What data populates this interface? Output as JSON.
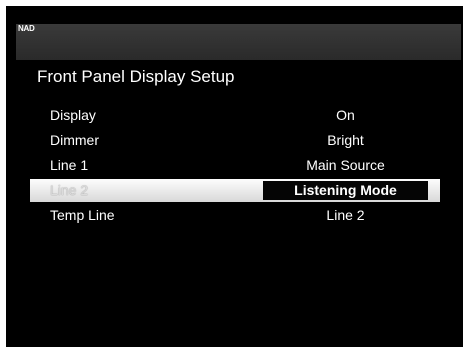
{
  "header": {
    "brand": "NAD",
    "title": "Front Panel Display Setup"
  },
  "menu": {
    "items": [
      {
        "label": "Display",
        "value": "On"
      },
      {
        "label": "Dimmer",
        "value": "Bright"
      },
      {
        "label": "Line 1",
        "value": "Main Source"
      },
      {
        "label": "Line 2",
        "value": "Listening Mode",
        "selected": true
      },
      {
        "label": "Temp Line",
        "value": "Line 2"
      }
    ]
  },
  "colors": {
    "background": "#000000",
    "topbar": "#333333",
    "text": "#ffffff",
    "highlight": "#ececec"
  }
}
